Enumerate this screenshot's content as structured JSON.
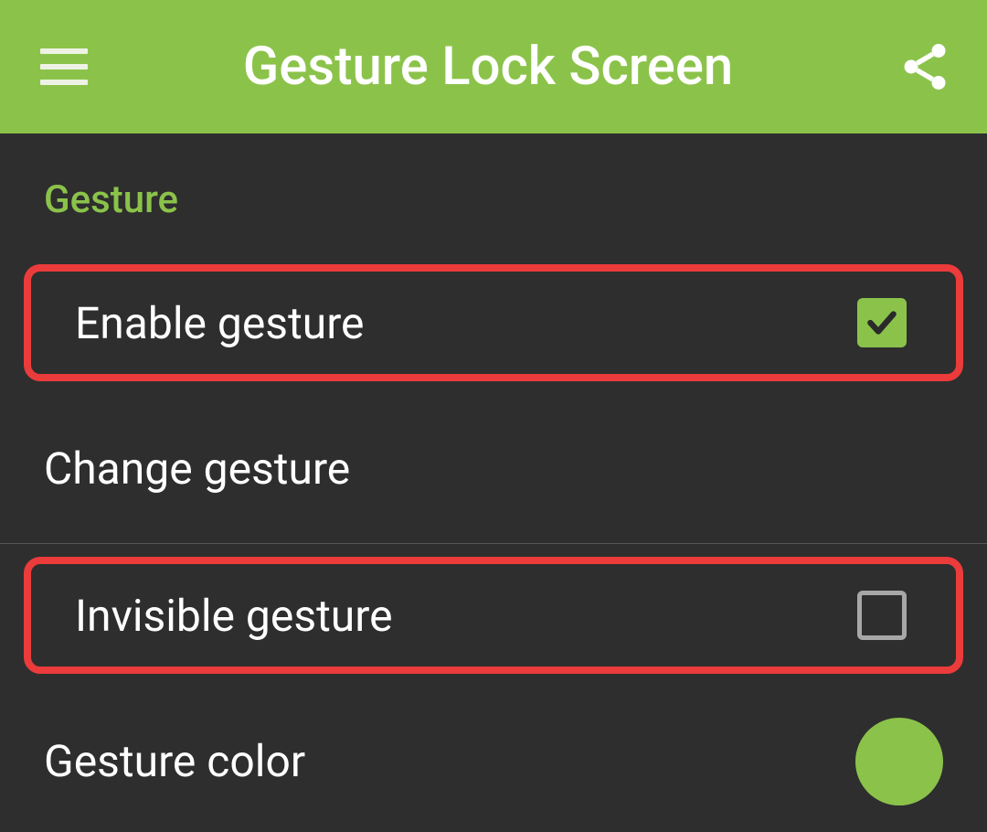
{
  "colors": {
    "accent": "#8bc34a",
    "header_bg": "#8bc34a",
    "background": "#2e2e2e",
    "highlight_border": "#eb3b3b"
  },
  "header": {
    "title": "Gesture Lock Screen"
  },
  "section": {
    "title": "Gesture",
    "items": [
      {
        "label": "Enable gesture",
        "checked": true
      },
      {
        "label": "Change gesture"
      },
      {
        "label": "Invisible gesture",
        "checked": false
      },
      {
        "label": "Gesture color",
        "color": "#8bc34a"
      }
    ]
  }
}
